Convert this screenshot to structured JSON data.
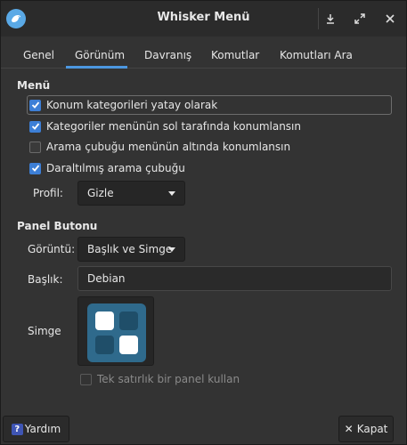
{
  "window": {
    "title": "Whisker Menü",
    "icons": {
      "app": "whisker-bird-icon",
      "minimize": "download-arrow-icon",
      "maximize": "expand-arrows-icon",
      "close": "close-icon"
    }
  },
  "tabs": [
    {
      "label": "Genel",
      "active": false
    },
    {
      "label": "Görünüm",
      "active": true
    },
    {
      "label": "Davranış",
      "active": false
    },
    {
      "label": "Komutlar",
      "active": false
    },
    {
      "label": "Komutları Ara",
      "active": false
    }
  ],
  "menu_section": {
    "title": "Menü",
    "options": [
      {
        "label": "Konum kategorileri yatay olarak",
        "checked": true
      },
      {
        "label": "Kategoriler menünün sol tarafında konumlansın",
        "checked": true
      },
      {
        "label": "Arama çubuğu menünün altında konumlansın",
        "checked": false
      },
      {
        "label": "Daraltılmış arama çubuğu",
        "checked": true
      }
    ],
    "profile_label": "Profil:",
    "profile_value": "Gizle"
  },
  "panel_section": {
    "title": "Panel Butonu",
    "display_label": "Görüntü:",
    "display_value": "Başlık ve Simge",
    "title_label": "Başlık:",
    "title_value": "Debian",
    "icon_label": "Simge",
    "icon_name": "whisker-menu-grid-icon",
    "single_row_label": "Tek satırlık bir panel kullan",
    "single_row_checked": false,
    "single_row_enabled": false
  },
  "buttons": {
    "help": "Yardım",
    "close": "Kapat"
  },
  "colors": {
    "accent": "#3d7fd6",
    "tab_underline": "#4c97e0",
    "icon_bg": "#2f6a8c",
    "icon_light": "#ffffff",
    "icon_dark": "#1f4e69"
  }
}
